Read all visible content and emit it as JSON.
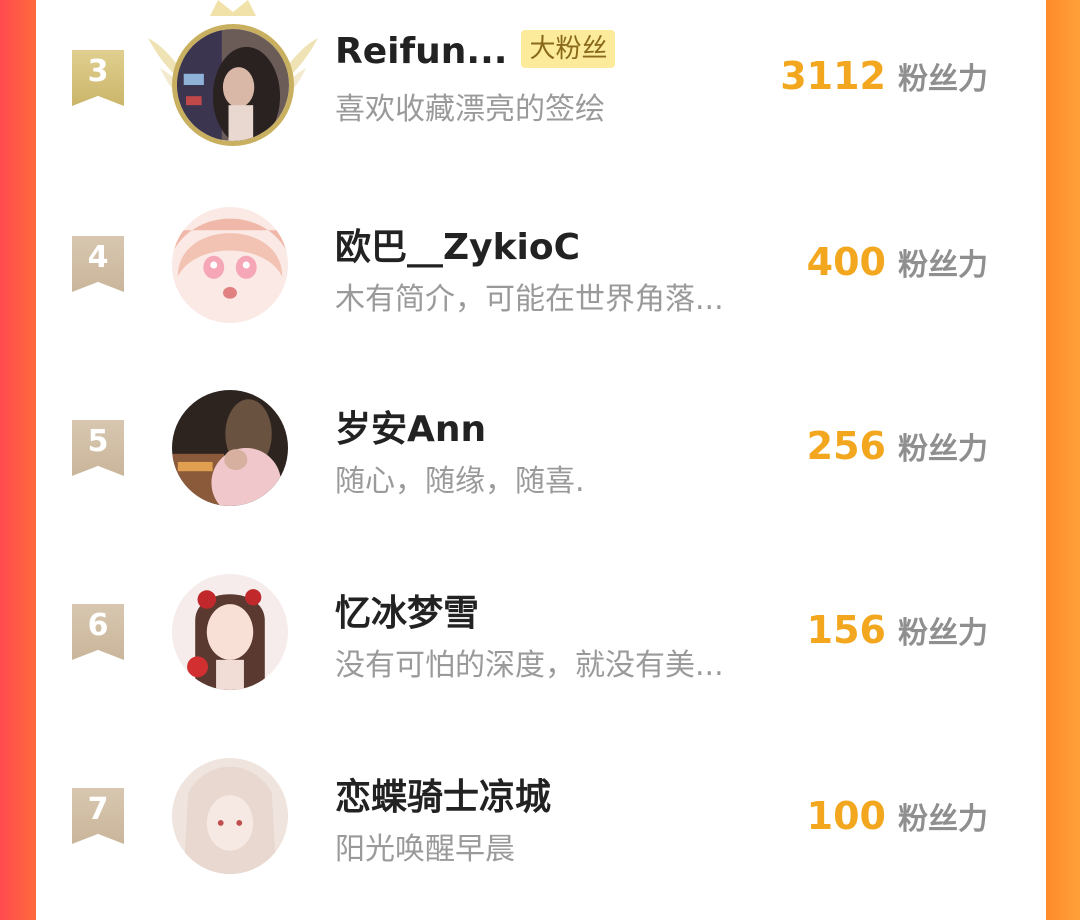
{
  "rows": [
    {
      "rank": "3",
      "name": "Reifun...",
      "tag": "大粉丝",
      "bio": "喜欢收藏漂亮的签绘",
      "score": "3112",
      "unit": "粉丝力"
    },
    {
      "rank": "4",
      "name": "欧巴__ZykioC",
      "bio": "木有简介，可能在世界角落...",
      "score": "400",
      "unit": "粉丝力"
    },
    {
      "rank": "5",
      "name": "岁安Ann",
      "bio": "随心，随缘，随喜.",
      "score": "256",
      "unit": "粉丝力"
    },
    {
      "rank": "6",
      "name": "忆冰梦雪",
      "bio": "没有可怕的深度，就没有美...",
      "score": "156",
      "unit": "粉丝力"
    },
    {
      "rank": "7",
      "name": "恋蝶骑士凉城",
      "bio": "阳光唤醒早晨",
      "score": "100",
      "unit": "粉丝力"
    }
  ],
  "colors": {
    "score": "#f2a71f",
    "badge": "#c9b59a",
    "gold_frame": "#c8b060",
    "tag_bg": "#fbeb9a"
  }
}
